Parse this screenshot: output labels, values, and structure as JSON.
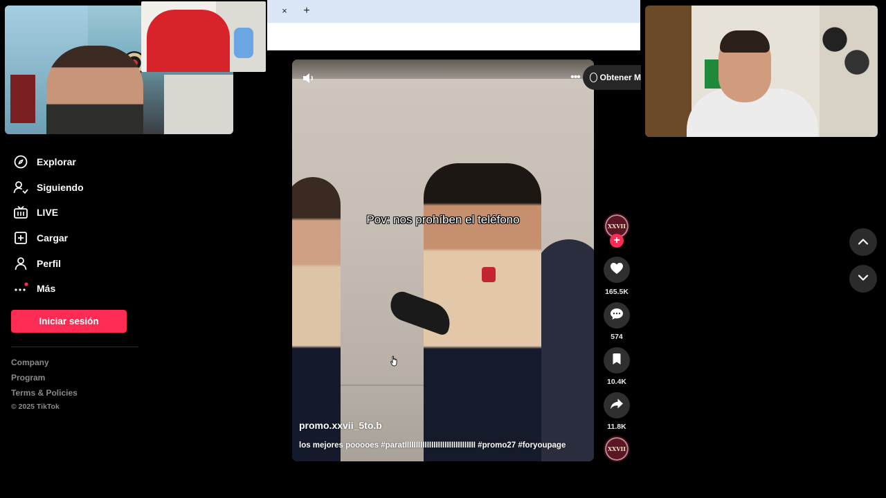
{
  "browser": {
    "tab_close_icon": "×",
    "new_tab_icon": "+"
  },
  "sidebar": {
    "items": [
      {
        "label": "Explorar",
        "icon": "compass-icon"
      },
      {
        "label": "Siguiendo",
        "icon": "user-follow-icon"
      },
      {
        "label": "LIVE",
        "icon": "live-tv-icon"
      },
      {
        "label": "Cargar",
        "icon": "plus-square-icon"
      },
      {
        "label": "Perfil",
        "icon": "user-icon"
      },
      {
        "label": "Más",
        "icon": "more-dots-icon"
      }
    ],
    "login_label": "Iniciar sesión",
    "footer": {
      "company": "Company",
      "program": "Program",
      "terms": "Terms & Policies",
      "copyright": "© 2025 TikTok"
    }
  },
  "video": {
    "overlay_text": "Pov: nos prohíben el teléfono",
    "author": "promo.xxvii_5to.b",
    "caption": "los mejores pooooes #paratIIIIIIIIIIIIIIIIIIIIIIIIIIIIIIII #promo27 #foryoupage",
    "get_app_label": "Obtener M",
    "more_icon": "•••"
  },
  "actions": {
    "avatar_text": "XXVII",
    "follow_icon": "+",
    "likes": "165.5K",
    "comments": "574",
    "saves": "10.4K",
    "shares": "11.8K"
  },
  "colors": {
    "accent": "#fe2c55",
    "background": "#000000",
    "button_bg": "#2f2f2f"
  }
}
